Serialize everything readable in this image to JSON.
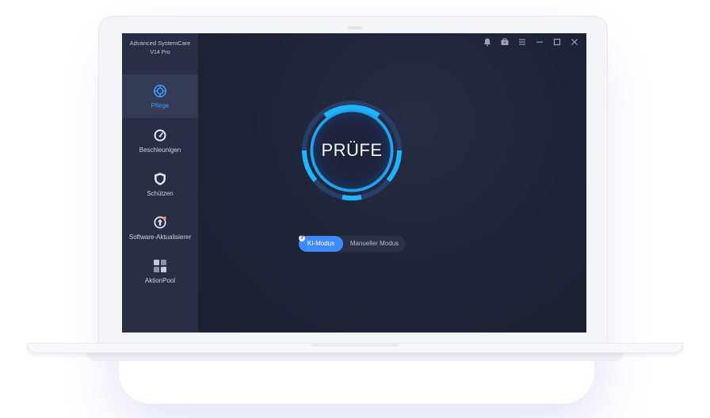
{
  "app": {
    "name": "Advanced SystemCare",
    "version": "V14  Pro"
  },
  "sidebar": {
    "items": [
      {
        "label": "Pflege",
        "icon": "care-icon",
        "active": true
      },
      {
        "label": "Beschleunigen",
        "icon": "speedometer-icon",
        "active": false
      },
      {
        "label": "Schützen",
        "icon": "shield-icon",
        "active": false
      },
      {
        "label": "Software-Aktualisierer",
        "icon": "update-icon",
        "active": false
      },
      {
        "label": "AktionPool",
        "icon": "grid-icon",
        "active": false
      }
    ]
  },
  "titlebar": {
    "icons": [
      "bell-icon",
      "toolbox-icon",
      "menu-icon",
      "minimize-icon",
      "maximize-icon",
      "close-icon"
    ]
  },
  "scan": {
    "label": "PRÜFE"
  },
  "mode": {
    "ai_label": "KI-Modus",
    "manual_label": "Manueller Modus",
    "selected": "KI-Modus",
    "help": "?"
  },
  "colors": {
    "accent": "#3d8bff",
    "sidebar": "#282e45",
    "background": "#1e2336",
    "ring": "#1fb4ff"
  }
}
